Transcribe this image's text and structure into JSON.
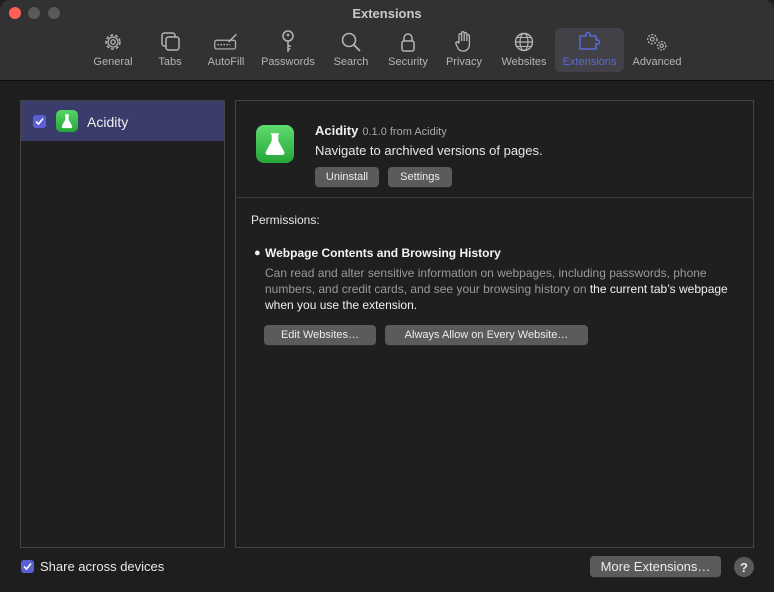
{
  "window": {
    "title": "Extensions"
  },
  "toolbar": [
    {
      "label": "General",
      "icon": "gear-icon"
    },
    {
      "label": "Tabs",
      "icon": "tabs-icon"
    },
    {
      "label": "AutoFill",
      "icon": "autofill-icon"
    },
    {
      "label": "Passwords",
      "icon": "key-icon"
    },
    {
      "label": "Search",
      "icon": "search-icon"
    },
    {
      "label": "Security",
      "icon": "lock-icon"
    },
    {
      "label": "Privacy",
      "icon": "hand-icon"
    },
    {
      "label": "Websites",
      "icon": "globe-icon"
    },
    {
      "label": "Extensions",
      "icon": "puzzle-icon",
      "active": true
    },
    {
      "label": "Advanced",
      "icon": "gears-icon"
    }
  ],
  "sidebar": {
    "items": [
      {
        "name": "Acidity",
        "enabled": true,
        "selected": true,
        "icon": "flask-icon"
      }
    ]
  },
  "detail": {
    "name": "Acidity",
    "version_line": "0.1.0 from Acidity",
    "description": "Navigate to archived versions of pages.",
    "uninstall_label": "Uninstall",
    "settings_label": "Settings",
    "permissions_title": "Permissions:",
    "permission": {
      "heading": "Webpage Contents and Browsing History",
      "body_part1": "Can read and alter sensitive information on webpages, including passwords, phone numbers, and credit cards, and see your browsing history on ",
      "body_highlight": "the current tab’s webpage when you use the extension",
      "body_end": "."
    },
    "edit_websites_label": "Edit Websites…",
    "always_allow_label": "Always Allow on Every Website…"
  },
  "footer": {
    "share_label": "Share across devices",
    "share_checked": true,
    "more_extensions_label": "More Extensions…",
    "help_label": "?"
  },
  "colors": {
    "accent": "#5b5fd6",
    "selection": "#3a3d6b",
    "extension_icon": "#34c04a"
  }
}
